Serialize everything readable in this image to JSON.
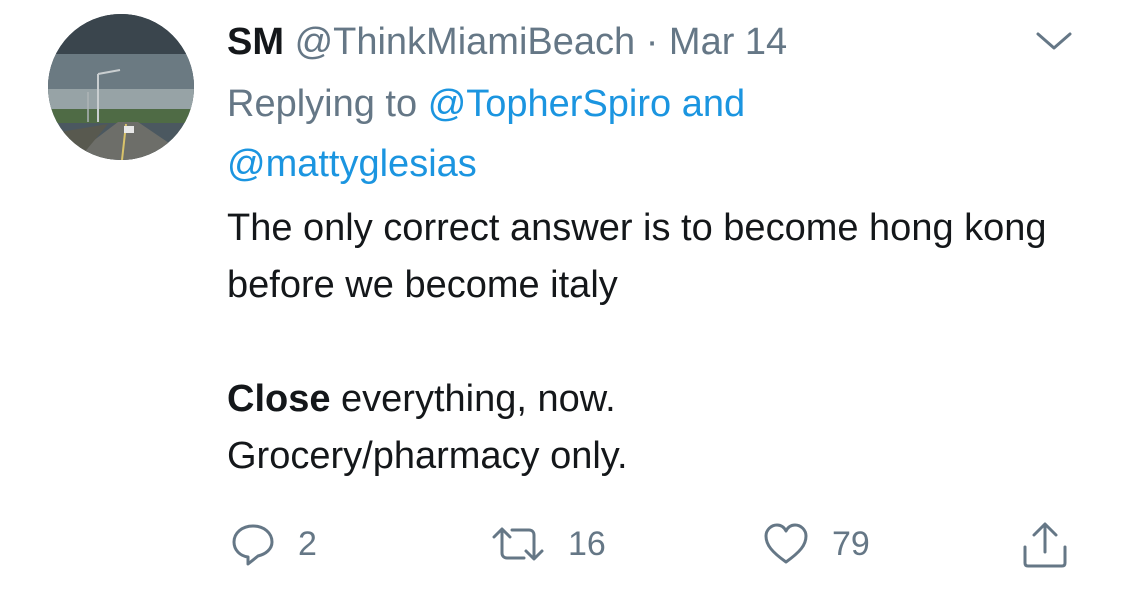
{
  "tweet": {
    "display_name": "SM",
    "handle": "@ThinkMiamiBeach",
    "separator": "·",
    "date": "Mar 14",
    "reply_prefix": "Replying to",
    "reply_mention_1": "@TopherSpiro",
    "reply_and": "and",
    "reply_mention_2": "@mattyglesias",
    "body_line1": "The only correct answer is to become hong kong before we become italy",
    "body_close_bold": "Close",
    "body_close_rest": " everything, now.",
    "body_line3": "Grocery/pharmacy only."
  },
  "actions": {
    "reply_count": "2",
    "retweet_count": "16",
    "like_count": "79"
  },
  "icons": {
    "avatar": "avatar-image",
    "menu": "chevron-down-icon",
    "reply": "reply-icon",
    "retweet": "retweet-icon",
    "like": "heart-icon",
    "share": "share-icon"
  },
  "colors": {
    "text": "#14171a",
    "secondary": "#657786",
    "link": "#1b95e0"
  }
}
